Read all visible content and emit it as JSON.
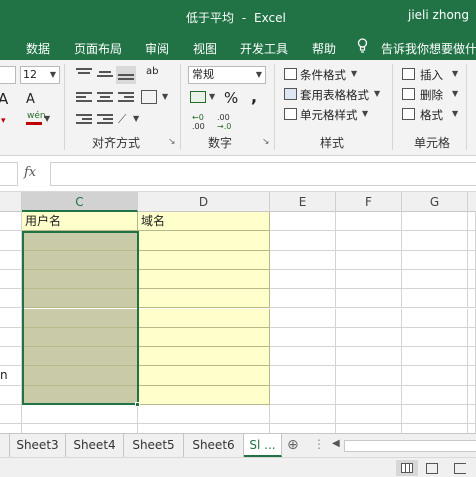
{
  "title": {
    "document": "低于平均",
    "separator": "-",
    "app": "Excel",
    "user": "jieli zhong"
  },
  "menu": {
    "items": [
      "数据",
      "页面布局",
      "审阅",
      "视图",
      "开发工具",
      "帮助"
    ],
    "tell_me": "告诉我你想要做什么"
  },
  "ribbon": {
    "font_size": "12",
    "number_format": "常规",
    "groups": {
      "alignment": "对齐方式",
      "number": "数字",
      "styles": "样式",
      "cells": "单元格"
    },
    "styles": {
      "conditional_formatting": "条件格式",
      "format_as_table": "套用表格格式",
      "cell_styles": "单元格样式"
    },
    "cells": {
      "insert": "插入",
      "delete": "删除",
      "format": "格式"
    },
    "glyphs": {
      "font_grow": "A",
      "font_shrink": "A",
      "phonetic": "wén",
      "percent": "%",
      "comma": ",",
      "wrap": "ab",
      "dec_increase": ".00",
      "dec_decrease": ".00",
      "dec_increase_b": "→.0",
      "dec_decrease_b": ".0→"
    },
    "colors": {
      "font_color": "#c00000",
      "accent": "#217346"
    }
  },
  "formula_bar": {
    "fx": "fx",
    "value": ""
  },
  "sheet": {
    "columns": [
      "C",
      "D",
      "E",
      "F",
      "G"
    ],
    "selected_column": "C",
    "header_row": {
      "C": "用户名",
      "D": "域名"
    },
    "partial_text": "n"
  },
  "tabs": {
    "sheets": [
      "Sheet3",
      "Sheet4",
      "Sheet5",
      "Sheet6",
      "Sl ..."
    ],
    "active_index": 4,
    "add_glyph": "⊕"
  }
}
